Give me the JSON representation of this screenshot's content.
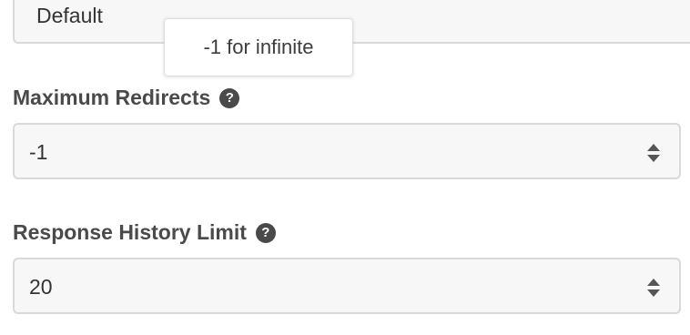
{
  "top_field": {
    "value": "Default"
  },
  "tooltip": {
    "text": "-1 for infinite"
  },
  "max_redirects": {
    "label": "Maximum Redirects",
    "help_icon": "question-circle-icon",
    "value": "-1"
  },
  "response_history": {
    "label": "Response History Limit",
    "help_icon": "question-circle-icon",
    "value": "20"
  },
  "colors": {
    "field_background": "#f7f7f7",
    "field_border": "#d9d9d9",
    "label_text": "#4a4a4a"
  }
}
